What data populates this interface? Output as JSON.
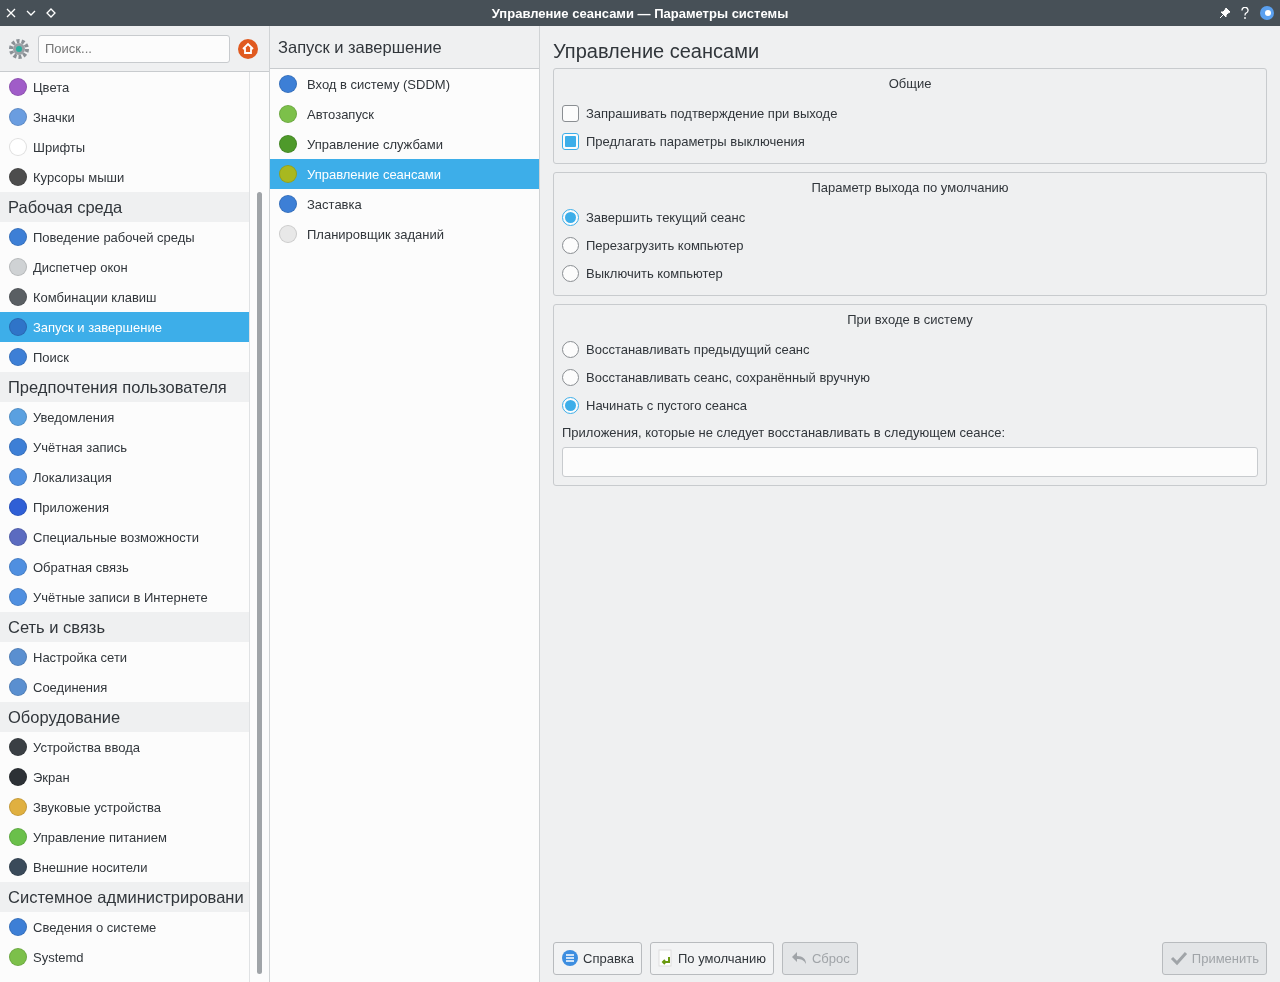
{
  "window": {
    "title": "Управление сеансами — Параметры системы"
  },
  "search": {
    "placeholder": "Поиск..."
  },
  "sidebar": {
    "groups": [
      {
        "items": [
          {
            "label": "Цвета",
            "color": "#a05cc8",
            "selected": false
          },
          {
            "label": "Значки",
            "color": "#6a9de0",
            "selected": false
          },
          {
            "label": "Шрифты",
            "color": "#ffffff",
            "selected": false
          },
          {
            "label": "Курсоры мыши",
            "color": "#4d4d4d",
            "selected": false
          }
        ]
      },
      {
        "heading": "Рабочая среда",
        "items": [
          {
            "label": "Поведение рабочей среды",
            "color": "#3d7fd6",
            "selected": false
          },
          {
            "label": "Диспетчер окон",
            "color": "#cfd2d4",
            "selected": false
          },
          {
            "label": "Комбинации клавиш",
            "color": "#5a5f63",
            "selected": false
          },
          {
            "label": "Запуск и завершение",
            "color": "#2f74c8",
            "selected": true
          },
          {
            "label": "Поиск",
            "color": "#3d7fd6",
            "selected": false
          }
        ]
      },
      {
        "heading": "Предпочтения пользователя",
        "items": [
          {
            "label": "Уведомления",
            "color": "#5aa0e0",
            "selected": false
          },
          {
            "label": "Учётная запись",
            "color": "#3d7fd6",
            "selected": false
          },
          {
            "label": "Локализация",
            "color": "#4f8fe0",
            "selected": false
          },
          {
            "label": "Приложения",
            "color": "#2f5fd6",
            "selected": false
          },
          {
            "label": "Специальные возможности",
            "color": "#5b6bc0",
            "selected": false
          },
          {
            "label": "Обратная связь",
            "color": "#4f8fe0",
            "selected": false
          },
          {
            "label": "Учётные записи в Интернете",
            "color": "#4f8fe0",
            "selected": false
          }
        ]
      },
      {
        "heading": "Сеть и связь",
        "items": [
          {
            "label": "Настройка сети",
            "color": "#5a8fd0",
            "selected": false
          },
          {
            "label": "Соединения",
            "color": "#5a8fd0",
            "selected": false
          }
        ]
      },
      {
        "heading": "Оборудование",
        "items": [
          {
            "label": "Устройства ввода",
            "color": "#3a3f44",
            "selected": false
          },
          {
            "label": "Экран",
            "color": "#2d3136",
            "selected": false
          },
          {
            "label": "Звуковые устройства",
            "color": "#e0b040",
            "selected": false
          },
          {
            "label": "Управление питанием",
            "color": "#6ac04a",
            "selected": false
          },
          {
            "label": "Внешние носители",
            "color": "#3a4a5a",
            "selected": false
          }
        ]
      },
      {
        "heading": "Системное администрировани",
        "items": [
          {
            "label": "Сведения о системе",
            "color": "#3d7fd6",
            "selected": false
          },
          {
            "label": "Systemd",
            "color": "#7cc04a",
            "selected": false
          }
        ]
      }
    ]
  },
  "middle": {
    "title": "Запуск и завершение",
    "items": [
      {
        "label": "Вход в систему (SDDM)",
        "color": "#3d7fd6",
        "selected": false
      },
      {
        "label": "Автозапуск",
        "color": "#7cc04a",
        "selected": false
      },
      {
        "label": "Управление службами",
        "color": "#4e9a2a",
        "selected": false
      },
      {
        "label": "Управление сеансами",
        "color": "#a8b820",
        "selected": true
      },
      {
        "label": "Заставка",
        "color": "#3d7fd6",
        "selected": false
      },
      {
        "label": "Планировщик заданий",
        "color": "#e8e8e8",
        "selected": false
      }
    ]
  },
  "page": {
    "title": "Управление сеансами",
    "groups": [
      {
        "title": "Общие",
        "options": [
          {
            "kind": "checkbox",
            "label": "Запрашивать подтверждение при выходе",
            "checked": false
          },
          {
            "kind": "checkbox",
            "label": "Предлагать параметры выключения",
            "checked": true
          }
        ]
      },
      {
        "title": "Параметр выхода по умолчанию",
        "options": [
          {
            "kind": "radio",
            "label": "Завершить текущий сеанс",
            "selected": true
          },
          {
            "kind": "radio",
            "label": "Перезагрузить компьютер",
            "selected": false
          },
          {
            "kind": "radio",
            "label": "Выключить компьютер",
            "selected": false
          }
        ]
      },
      {
        "title": "При входе в систему",
        "options": [
          {
            "kind": "radio",
            "label": "Восстанавливать предыдущий сеанс",
            "selected": false
          },
          {
            "kind": "radio",
            "label": "Восстанавливать сеанс, сохранённый вручную",
            "selected": false
          },
          {
            "kind": "radio",
            "label": "Начинать с пустого сеанса",
            "selected": true
          }
        ],
        "field_label": "Приложения, которые не следует восстанавливать в следующем сеансе:"
      }
    ]
  },
  "buttons": [
    {
      "label": "Справка",
      "kind": "help",
      "disabled": false
    },
    {
      "label": "По умолчанию",
      "kind": "defaults",
      "disabled": false
    },
    {
      "label": "Сброс",
      "kind": "reset",
      "disabled": true
    },
    {
      "label": "Применить",
      "kind": "apply",
      "disabled": true
    }
  ]
}
